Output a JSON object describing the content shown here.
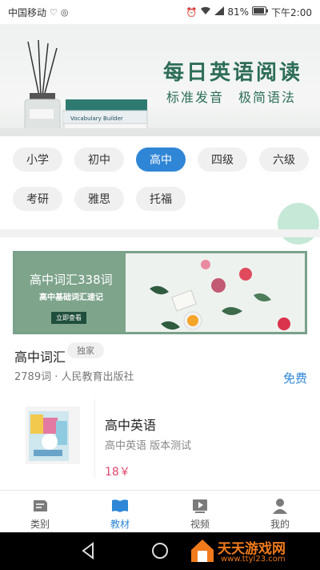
{
  "status_bar": {
    "carrier": "中国移动",
    "battery": "81%",
    "time": "下午2:00"
  },
  "banner": {
    "title": "每日英语阅读",
    "subtitle": "标准发音　极简语法",
    "book_text": "Vocabulary Builder"
  },
  "categories": {
    "row1": [
      "小学",
      "初中",
      "高中",
      "四级",
      "六级"
    ],
    "row2": [
      "考研",
      "雅思",
      "托福"
    ],
    "selected": "高中"
  },
  "featured": {
    "banner_title": "高中词汇338词",
    "banner_subtitle": "高中基础词汇速记",
    "banner_button": "立即查看",
    "title": "高中词汇",
    "badge": "独家",
    "meta": "2789词 · 人民教育出版社",
    "price": "免费"
  },
  "book": {
    "title": "高中英语",
    "description": "高中英语 版本测试",
    "price": "18￥"
  },
  "tabs": [
    {
      "label": "类别",
      "icon": "category-icon"
    },
    {
      "label": "教材",
      "icon": "book-icon"
    },
    {
      "label": "视频",
      "icon": "video-icon"
    },
    {
      "label": "我的",
      "icon": "profile-icon"
    }
  ],
  "active_tab": "教材",
  "watermark": {
    "title": "天天游戏网",
    "url": "www.ttyl23.com"
  },
  "colors": {
    "accent": "#2f86d6",
    "brand_green": "#2d6d58",
    "price_red": "#e0486d"
  }
}
